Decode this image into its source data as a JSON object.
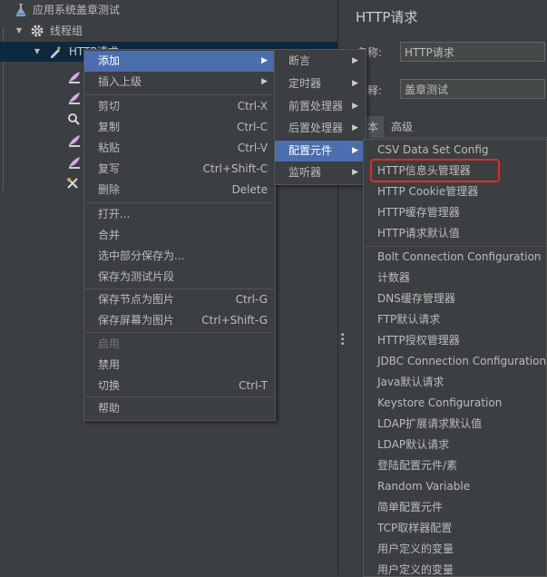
{
  "tree": {
    "root_label": "应用系统盖章测试",
    "thread_group_label": "线程组",
    "http_request_label": "HTTP请求"
  },
  "right_panel": {
    "title": "HTTP请求",
    "name_label": "名称:",
    "name_value": "HTTP请求",
    "comment_label": "注释:",
    "comment_value": "盖章测试",
    "tab_basic": "基本",
    "tab_advanced": "高级"
  },
  "context_menu": {
    "items": [
      {
        "label": "添加",
        "shortcut": "",
        "submenu": true,
        "highlighted": true
      },
      {
        "label": "插入上级",
        "shortcut": "",
        "submenu": true
      },
      {
        "label": "剪切",
        "shortcut": "Ctrl-X"
      },
      {
        "label": "复制",
        "shortcut": "Ctrl-C"
      },
      {
        "label": "粘贴",
        "shortcut": "Ctrl-V"
      },
      {
        "label": "复写",
        "shortcut": "Ctrl+Shift-C"
      },
      {
        "label": "删除",
        "shortcut": "Delete"
      },
      {
        "label": "打开...",
        "shortcut": ""
      },
      {
        "label": "合并",
        "shortcut": ""
      },
      {
        "label": "选中部分保存为...",
        "shortcut": ""
      },
      {
        "label": "保存为测试片段",
        "shortcut": ""
      },
      {
        "label": "保存节点为图片",
        "shortcut": "Ctrl-G"
      },
      {
        "label": "保存屏幕为图片",
        "shortcut": "Ctrl+Shift-G"
      },
      {
        "label": "启用",
        "shortcut": "",
        "disabled": true
      },
      {
        "label": "禁用",
        "shortcut": ""
      },
      {
        "label": "切换",
        "shortcut": "Ctrl-T"
      },
      {
        "label": "帮助",
        "shortcut": ""
      }
    ]
  },
  "add_submenu": {
    "items": [
      {
        "label": "断言",
        "submenu": true
      },
      {
        "label": "定时器",
        "submenu": true
      },
      {
        "label": "前置处理器",
        "submenu": true
      },
      {
        "label": "后置处理器",
        "submenu": true
      },
      {
        "label": "配置元件",
        "submenu": true,
        "highlighted": true
      },
      {
        "label": "监听器",
        "submenu": true
      }
    ]
  },
  "config_submenu": {
    "items": [
      "CSV Data Set Config",
      "HTTP信息头管理器",
      "HTTP Cookie管理器",
      "HTTP缓存管理器",
      "HTTP请求默认值",
      "Bolt Connection Configuration",
      "计数器",
      "DNS缓存管理器",
      "FTP默认请求",
      "HTTP授权管理器",
      "JDBC Connection Configuration",
      "Java默认请求",
      "Keystore Configuration",
      "LDAP扩展请求默认值",
      "LDAP默认请求",
      "登陆配置元件/素",
      "Random Variable",
      "简单配置元件",
      "TCP取样器配置",
      "用户定义的变量",
      "用户定义的变量"
    ],
    "circled_item": "HTTP信息头管理器"
  },
  "colors": {
    "highlight": "#4b6eaf",
    "annotation_red": "#e8281e",
    "background": "#3c3f41"
  }
}
